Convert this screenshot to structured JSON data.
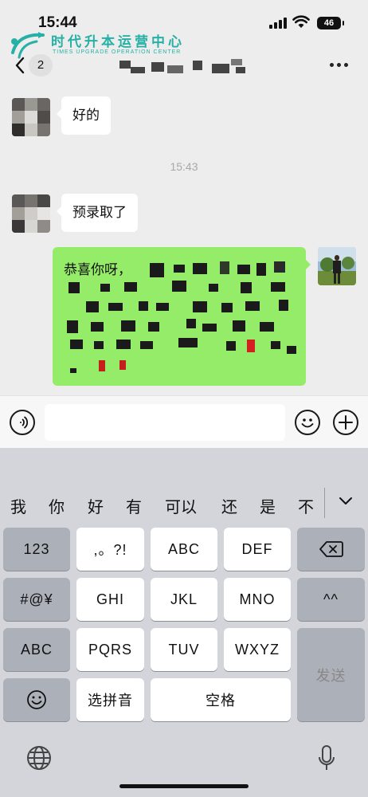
{
  "status_bar": {
    "time": "15:44",
    "battery": "46"
  },
  "watermark": {
    "name_cn": "时代升本运营中心",
    "name_en": "TIMES UPGRADE OPERATION CENTER"
  },
  "header": {
    "unread_count": "2"
  },
  "messages": [
    {
      "side": "left",
      "text": "好的"
    },
    {
      "type": "timestamp",
      "text": "15:43"
    },
    {
      "side": "left",
      "text": "预录取了"
    },
    {
      "side": "right",
      "text": "恭喜你呀，"
    }
  ],
  "keyboard": {
    "candidates": [
      "我",
      "你",
      "好",
      "有",
      "可以",
      "还",
      "是",
      "不"
    ],
    "keys": {
      "num": "123",
      "punct": ",。?!",
      "abc_lower": "ABC",
      "def": "DEF",
      "symbols": "#@¥",
      "ghi": "GHI",
      "jkl": "JKL",
      "mno": "MNO",
      "caret": "^^",
      "abc_mode": "ABC",
      "pqrs": "PQRS",
      "tuv": "TUV",
      "wxyz": "WXYZ",
      "send": "发送",
      "pinyin": "选拼音",
      "space": "空格"
    }
  },
  "icons": [
    "back-chevron-icon",
    "more-icon",
    "voice-icon",
    "emoji-icon",
    "add-icon",
    "delete-icon",
    "emoji-key-icon",
    "globe-icon",
    "mic-icon",
    "wifi-icon",
    "signal-icon"
  ]
}
